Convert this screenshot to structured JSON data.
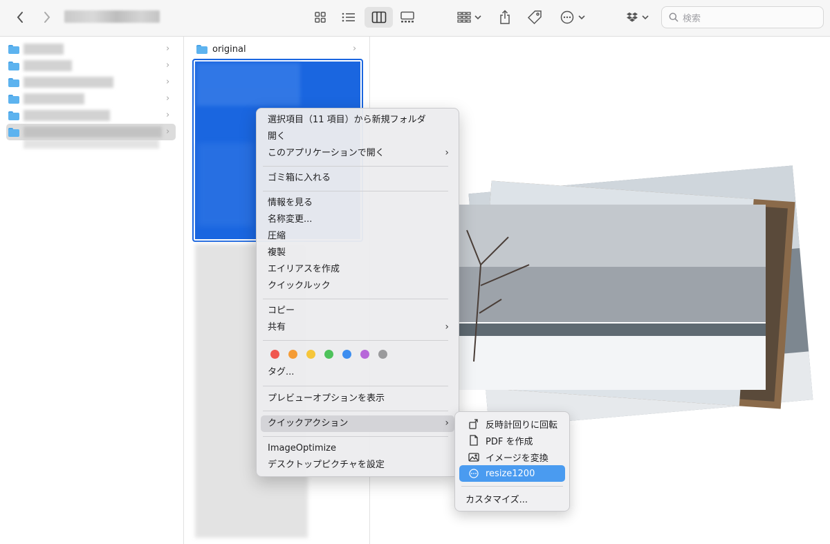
{
  "toolbar": {
    "back": "back",
    "forward": "forward",
    "search_placeholder": "検索"
  },
  "column2": {
    "folder_name": "original"
  },
  "context_menu": {
    "items": [
      "選択項目（11 項目）から新規フォルダ",
      "開く",
      "このアプリケーションで開く",
      "ゴミ箱に入れる",
      "情報を見る",
      "名称変更...",
      "圧縮",
      "複製",
      "エイリアスを作成",
      "クイックルック",
      "コピー",
      "共有",
      "タグ...",
      "プレビューオプションを表示",
      "クイックアクション",
      "ImageOptimize",
      "デスクトップピクチャを設定"
    ],
    "tag_colors": [
      "#f0574f",
      "#f59c36",
      "#f6c63b",
      "#4ec25b",
      "#3d8ef0",
      "#b767d9",
      "#9a9a9c"
    ]
  },
  "quick_actions": {
    "items": [
      {
        "label": "反時計回りに回転",
        "icon": "rotate-left-icon"
      },
      {
        "label": "PDF を作成",
        "icon": "document-icon"
      },
      {
        "label": "イメージを変換",
        "icon": "image-icon"
      },
      {
        "label": "resize1200",
        "icon": "workflow-icon"
      },
      {
        "label": "カスタマイズ...",
        "icon": ""
      }
    ]
  },
  "colors": {
    "accent": "#4a9bf0",
    "selection": "#1a66e0"
  }
}
